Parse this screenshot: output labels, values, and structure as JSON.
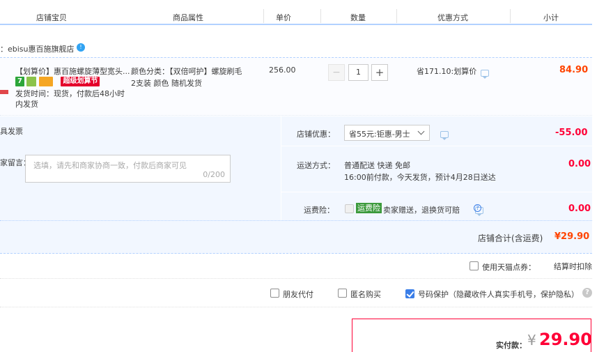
{
  "header": {
    "col_store_item": "店铺宝贝",
    "col_attrs": "商品属性",
    "col_price": "单价",
    "col_qty": "数量",
    "col_discount": "优惠方式",
    "col_subtotal": "小计"
  },
  "store": {
    "name": "：ebisu惠百施旗舰店",
    "chat_badge": "!"
  },
  "item": {
    "title": "【划算价】惠百施螺旋薄型宽头...",
    "badge_seven": "7",
    "badge_festival": "超级划算节",
    "shipping_time": "发货时间：现货，付款后48小时内发货",
    "attr_line1": "颜色分类：【双倍呵护】螺旋刷毛",
    "attr_line2": "2支装 颜色 随机发货",
    "unit_price": "256.00",
    "qty_minus": "−",
    "qty_value": "1",
    "qty_plus": "+",
    "discount": "省171.10:划算价",
    "subtotal": "84.90"
  },
  "options": {
    "invoice_label": "具发票",
    "message_label": "家留言：",
    "message_placeholder": "选填，请先和商家协商一致，付款后商家可见",
    "message_counter": "0/200",
    "store_discount_label": "店铺优惠：",
    "store_discount_value": "省55元:钜惠-男士",
    "store_discount_amount": "-55.00",
    "shipping_label": "运送方式：",
    "shipping_line1": "普通配送 快递 免邮",
    "shipping_line2": "16:00前付款，今天发货，预计4月28日送达",
    "shipping_amount": "0.00",
    "insurance_label": "运费险：",
    "insurance_badge": "运费险",
    "insurance_text": "卖家赠送，退换货可赔",
    "insurance_amount": "0.00"
  },
  "store_total": {
    "label": "店铺合计(含运费)",
    "value": "¥29.90"
  },
  "coupon": {
    "tmall_coupon_label": "使用天猫点券：",
    "settle_deduct": "结算时扣除"
  },
  "extras": {
    "friend_pay": "朋友代付",
    "anonymous": "匿名购买",
    "number_protect": "号码保护（隐藏收件人真实手机号，保护隐私）",
    "help_icon": "?"
  },
  "payment": {
    "label": "实付款：",
    "currency": "¥",
    "amount": "29.90"
  }
}
